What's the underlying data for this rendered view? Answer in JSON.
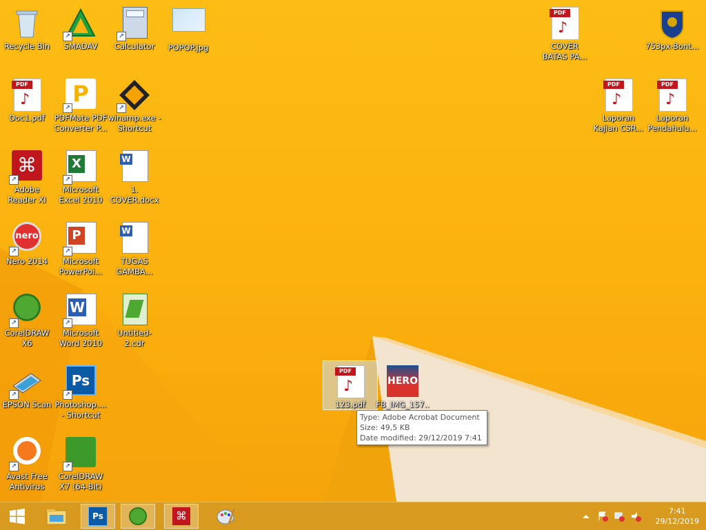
{
  "desktop_icons": [
    {
      "id": "recycle-bin",
      "label": "Recycle Bin"
    },
    {
      "id": "smadav",
      "label": "SMADAV"
    },
    {
      "id": "calculator",
      "label": "Calculator"
    },
    {
      "id": "popop",
      "label": "POPOP.jpg"
    },
    {
      "id": "cover-batas",
      "label": "COVER BATAS PA..."
    },
    {
      "id": "bontang",
      "label": "753px-Bont..."
    },
    {
      "id": "doc1",
      "label": "Doc1.pdf"
    },
    {
      "id": "pdfmate",
      "label": "PDFMate PDF Converter P..."
    },
    {
      "id": "winamp",
      "label": "winamp.exe - Shortcut"
    },
    {
      "id": "laporan-kajian",
      "label": "Laporan Kajian CSR..."
    },
    {
      "id": "laporan-pendahuluan",
      "label": "Laporan Pendahulu..."
    },
    {
      "id": "adobe-reader",
      "label": "Adobe Reader XI"
    },
    {
      "id": "excel",
      "label": "Microsoft Excel 2010"
    },
    {
      "id": "cover-docx",
      "label": "1. COVER.docx"
    },
    {
      "id": "nero",
      "label": "Nero 2014"
    },
    {
      "id": "powerpoint",
      "label": "Microsoft PowerPoi..."
    },
    {
      "id": "tugas",
      "label": "TUGAS GAMBA..."
    },
    {
      "id": "coreldraw-x6",
      "label": "CorelDRAW X6"
    },
    {
      "id": "word",
      "label": "Microsoft Word 2010"
    },
    {
      "id": "untitled-cdr",
      "label": "Untitled-2.cdr"
    },
    {
      "id": "epson",
      "label": "EPSON Scan"
    },
    {
      "id": "photoshop",
      "label": "Photoshop.... - Shortcut"
    },
    {
      "id": "avast",
      "label": "Avast Free Antivirus"
    },
    {
      "id": "coreldraw-x7",
      "label": "CorelDRAW X7 (64-Bit)"
    },
    {
      "id": "file-123",
      "label": "123.pdf"
    },
    {
      "id": "fb-img",
      "label": "FB_IMG_157..."
    }
  ],
  "tooltip": {
    "type": "Type: Adobe Acrobat Document",
    "size": "Size: 49,5 KB",
    "modified": "Date modified: 29/12/2019 7:41"
  },
  "clock": {
    "time": "7:41",
    "date": "29/12/2019"
  },
  "colors": {
    "background": "#fbb10e",
    "taskbar": "#d69614",
    "pdf_red": "#c0161d"
  }
}
